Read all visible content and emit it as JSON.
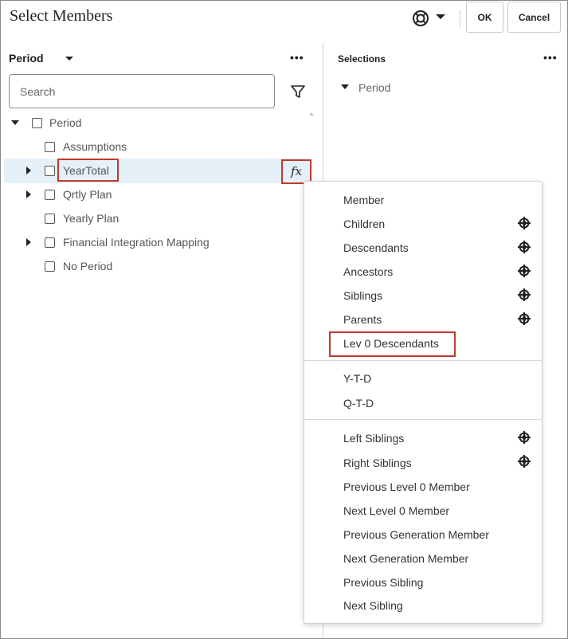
{
  "dialog": {
    "title": "Select Members",
    "ok_label": "OK",
    "cancel_label": "Cancel"
  },
  "left_panel": {
    "dimension_label": "Period",
    "more": "•••",
    "search_placeholder": "Search",
    "tree": [
      {
        "label": "Period",
        "expanded": true,
        "checked": false
      },
      {
        "label": "Assumptions",
        "checked": false
      },
      {
        "label": "YearTotal",
        "checked": false,
        "selected": true
      },
      {
        "label": "Qrtly Plan",
        "checked": false
      },
      {
        "label": "Yearly Plan",
        "checked": false
      },
      {
        "label": "Financial Integration Mapping",
        "checked": false
      },
      {
        "label": "No Period",
        "checked": false
      }
    ],
    "fx_label": "fx"
  },
  "right_panel": {
    "title": "Selections",
    "more": "•••",
    "items": [
      {
        "label": "Period"
      }
    ]
  },
  "function_menu": {
    "items": [
      {
        "label": "Member"
      },
      {
        "label": "Children",
        "icon": "target-icon"
      },
      {
        "label": "Descendants",
        "icon": "target-icon"
      },
      {
        "label": "Ancestors",
        "icon": "target-icon"
      },
      {
        "label": "Siblings",
        "icon": "target-icon"
      },
      {
        "label": "Parents",
        "icon": "target-icon"
      },
      {
        "label": "Lev 0 Descendants",
        "highlighted": true
      },
      {
        "label": "Y-T-D"
      },
      {
        "label": "Q-T-D"
      },
      {
        "label": "Left Siblings",
        "icon": "target-icon"
      },
      {
        "label": "Right Siblings",
        "icon": "target-icon"
      },
      {
        "label": "Previous Level 0 Member"
      },
      {
        "label": "Next Level 0 Member"
      },
      {
        "label": "Previous Generation Member"
      },
      {
        "label": "Next Generation Member"
      },
      {
        "label": "Previous Sibling"
      },
      {
        "label": "Next Sibling"
      }
    ]
  },
  "colors": {
    "highlight_border": "#c0392b",
    "selected_row": "#e6f0f8"
  }
}
